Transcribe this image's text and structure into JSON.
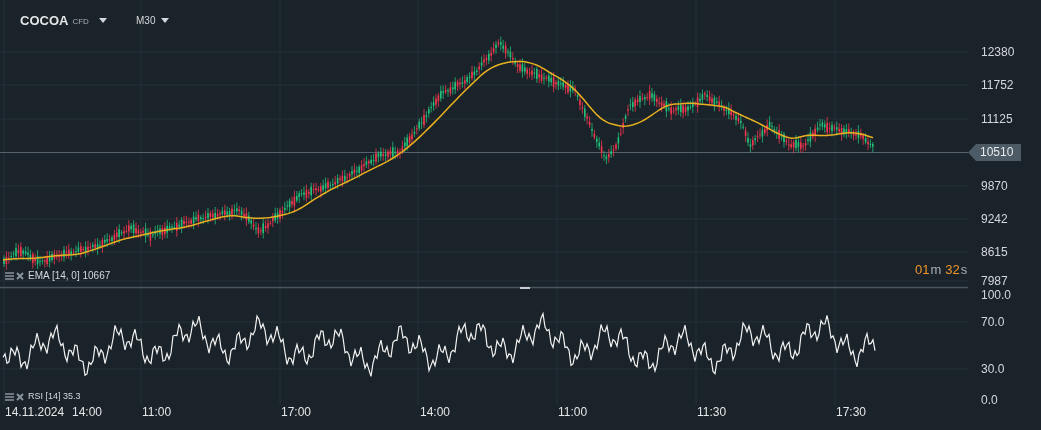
{
  "header": {
    "symbol": "COCOA",
    "instrument_type": "CFD",
    "timeframe": "M30"
  },
  "price_axis": [
    "12380",
    "11752",
    "11125",
    "9870",
    "9242",
    "8615",
    "7987"
  ],
  "current_price": {
    "label": "10510"
  },
  "countdown": {
    "minutes": "01",
    "minutes_unit": "m",
    "seconds": "32",
    "seconds_unit": "s"
  },
  "ema_legend": {
    "label": "EMA [14, 0] 10667"
  },
  "rsi_legend": {
    "label": "RSI [14] 35.3"
  },
  "rsi_axis": [
    "100.0",
    "70.0",
    "30.0",
    "0.0"
  ],
  "time_axis": [
    "14.11.2024",
    "14:00",
    "11:00",
    "17:00",
    "14:00",
    "11:00",
    "11:30",
    "17:30"
  ]
}
